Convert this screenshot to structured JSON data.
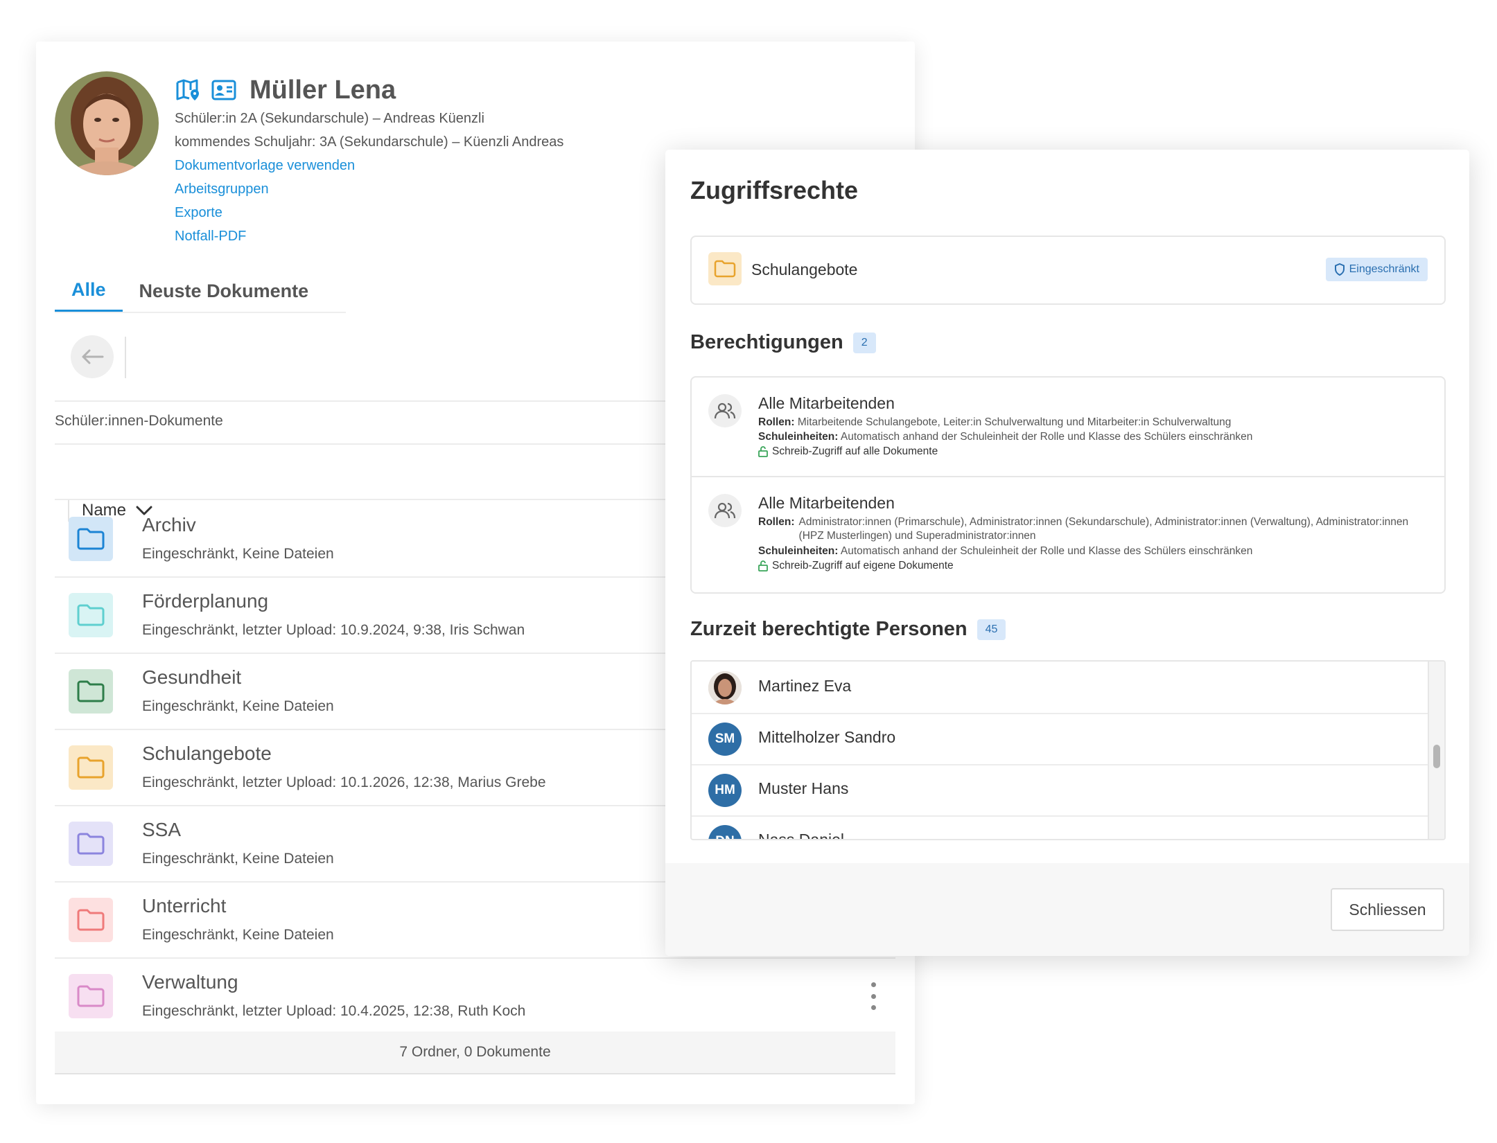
{
  "student": {
    "name": "Müller Lena",
    "class_line": "Schüler:in 2A (Sekundarschule) – Andreas Küenzli",
    "next_year_line": "kommendes Schuljahr: 3A (Sekundarschule) – Küenzli Andreas",
    "links": [
      "Dokumentvorlage verwenden",
      "Arbeitsgruppen",
      "Exporte",
      "Notfall-PDF"
    ]
  },
  "tabs": [
    {
      "label": "Alle",
      "active": true
    },
    {
      "label": "Neuste Dokumente",
      "active": false
    }
  ],
  "breadcrumb": "Schüler:innen-Dokumente",
  "sort": {
    "label": "Name"
  },
  "folders": [
    {
      "title": "Archiv",
      "subtitle": "Eingeschränkt, Keine Dateien",
      "color": "#1c84d4",
      "bg": "#d2e6f7"
    },
    {
      "title": "Förderplanung",
      "subtitle": "Eingeschränkt, letzter Upload: 10.9.2024, 9:38, Iris Schwan",
      "color": "#5fcfcf",
      "bg": "#d9f4f4"
    },
    {
      "title": "Gesundheit",
      "subtitle": "Eingeschränkt, Keine Dateien",
      "color": "#2e7d4a",
      "bg": "#cfe6d6"
    },
    {
      "title": "Schulangebote",
      "subtitle": "Eingeschränkt, letzter Upload: 10.1.2026, 12:38, Marius Grebe",
      "color": "#e8a32d",
      "bg": "#fbe8c6"
    },
    {
      "title": "SSA",
      "subtitle": "Eingeschränkt, Keine Dateien",
      "color": "#8b84de",
      "bg": "#e4e2f8"
    },
    {
      "title": "Unterricht",
      "subtitle": "Eingeschränkt, Keine Dateien",
      "color": "#ef7a7a",
      "bg": "#fde0e0"
    },
    {
      "title": "Verwaltung",
      "subtitle": "Eingeschränkt, letzter Upload: 10.4.2025, 12:38, Ruth Koch",
      "color": "#d98ac8",
      "bg": "#f7dff1"
    }
  ],
  "footer_summary": "7 Ordner, 0 Dokumente",
  "dialog": {
    "title": "Zugriffsrechte",
    "folder_name": "Schulangebote",
    "folder_badge": "Eingeschränkt",
    "permissions_title": "Berechtigungen",
    "permissions_count": "2",
    "permissions": [
      {
        "name": "Alle Mitarbeitenden",
        "roles_label": "Rollen:",
        "roles": "Mitarbeitende Schulangebote, Leiter:in Schulverwaltung und Mitarbeiter:in Schulverwaltung",
        "units_label": "Schuleinheiten:",
        "units": "Automatisch anhand der Schuleinheit der Rolle und Klasse des Schülers einschränken",
        "access": "Schreib-Zugriff auf alle Dokumente"
      },
      {
        "name": "Alle Mitarbeitenden",
        "roles_label": "Rollen:",
        "roles": "Administrator:innen (Primarschule), Administrator:innen (Sekundarschule), Administrator:innen (Verwaltung), Administrator:innen (HPZ Musterlingen) und Superadministrator:innen",
        "units_label": "Schuleinheiten:",
        "units": "Automatisch anhand der Schuleinheit der Rolle und Klasse des Schülers einschränken",
        "access": "Schreib-Zugriff auf eigene Dokumente"
      }
    ],
    "people_title": "Zurzeit berechtigte Personen",
    "people_count": "45",
    "people": [
      {
        "initials": "",
        "name": "Martinez Eva",
        "photo": true
      },
      {
        "initials": "SM",
        "name": "Mittelholzer Sandro",
        "photo": false
      },
      {
        "initials": "HM",
        "name": "Muster Hans",
        "photo": false
      },
      {
        "initials": "DN",
        "name": "Nass Daniel",
        "photo": false
      }
    ],
    "close_label": "Schliessen"
  },
  "colors": {
    "accent": "#1a8fd9",
    "avatar_blue": "#2e6ea6",
    "badge_bg": "#d8e8fa"
  }
}
